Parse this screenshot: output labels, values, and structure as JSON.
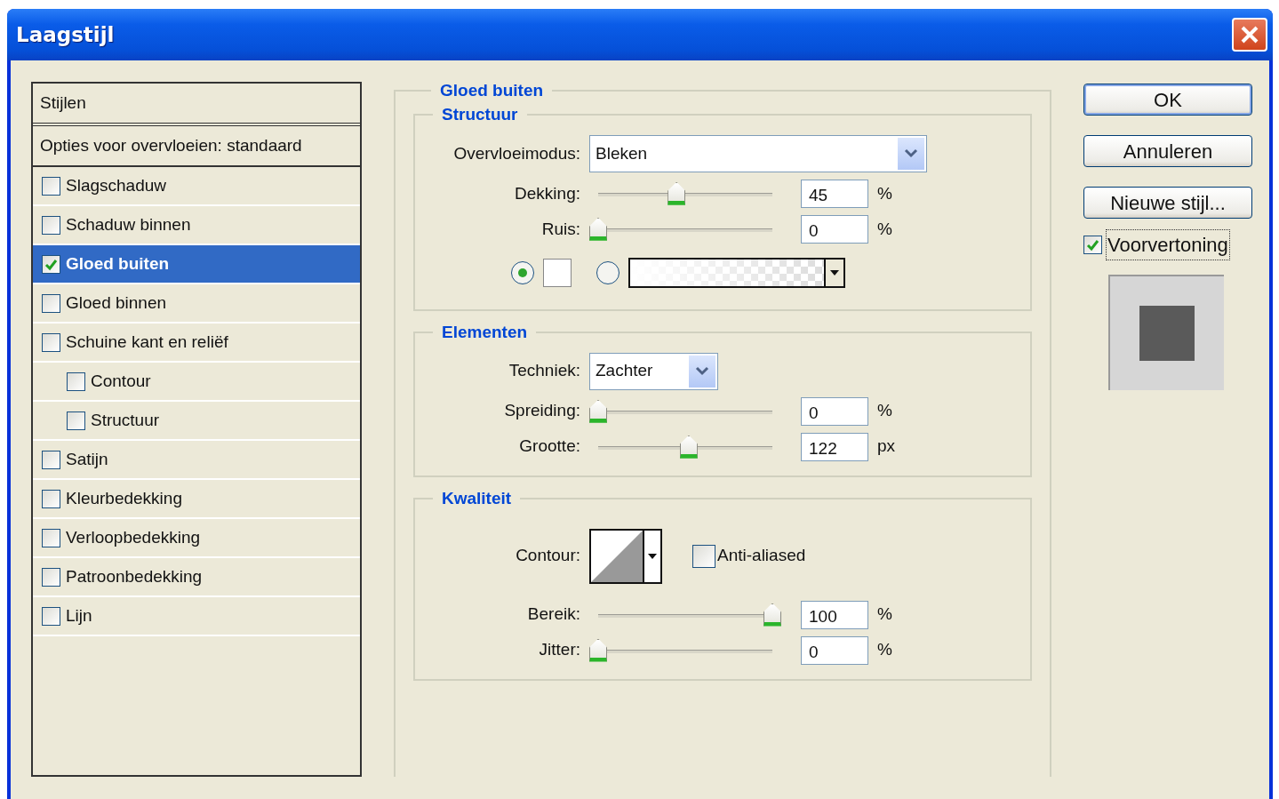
{
  "window": {
    "title": "Laagstijl"
  },
  "style_list": {
    "header": "Stijlen",
    "blend_options": "Opties voor overvloeien: standaard",
    "items": [
      {
        "label": "Slagschaduw",
        "checked": false,
        "selected": false
      },
      {
        "label": "Schaduw binnen",
        "checked": false,
        "selected": false
      },
      {
        "label": "Gloed buiten",
        "checked": true,
        "selected": true
      },
      {
        "label": "Gloed binnen",
        "checked": false,
        "selected": false
      },
      {
        "label": "Schuine kant en reliëf",
        "checked": false,
        "selected": false,
        "children": [
          {
            "label": "Contour",
            "checked": false,
            "selected": false
          },
          {
            "label": "Structuur",
            "checked": false,
            "selected": false
          }
        ]
      },
      {
        "label": "Satijn",
        "checked": false,
        "selected": false
      },
      {
        "label": "Kleurbedekking",
        "checked": false,
        "selected": false
      },
      {
        "label": "Verloopbedekking",
        "checked": false,
        "selected": false
      },
      {
        "label": "Patroonbedekking",
        "checked": false,
        "selected": false
      },
      {
        "label": "Lijn",
        "checked": false,
        "selected": false
      }
    ]
  },
  "panel": {
    "title": "Gloed buiten",
    "groups": [
      {
        "title": "Structuur",
        "rows": [
          {
            "kind": "dropdown",
            "label": "Overvloeimodus:",
            "value": "Bleken"
          },
          {
            "kind": "slider",
            "label": "Dekking:",
            "level": 0.45,
            "value": "45",
            "unit": "%"
          },
          {
            "kind": "slider",
            "label": "Ruis:",
            "level": 0,
            "value": "0",
            "unit": "%"
          },
          {
            "kind": "fill",
            "options": [
              {
                "kind": "color",
                "selected": true
              },
              {
                "kind": "gradient",
                "selected": false
              }
            ]
          }
        ]
      },
      {
        "title": "Elementen",
        "rows": [
          {
            "kind": "dropdown",
            "label": "Techniek:",
            "value": "Zachter"
          },
          {
            "kind": "slider",
            "label": "Spreiding:",
            "level": 0,
            "value": "0",
            "unit": "%"
          },
          {
            "kind": "slider",
            "label": "Grootte:",
            "level": 0.52,
            "value": "122",
            "unit": "px"
          }
        ]
      },
      {
        "title": "Kwaliteit",
        "rows": [
          {
            "kind": "contour",
            "label": "Contour:",
            "checkbox": {
              "label": "Anti-aliased",
              "checked": false
            }
          },
          {
            "kind": "slider",
            "label": "Bereik:",
            "level": 1,
            "value": "100",
            "unit": "%"
          },
          {
            "kind": "slider",
            "label": "Jitter:",
            "level": 0,
            "value": "0",
            "unit": "%"
          }
        ]
      }
    ]
  },
  "buttons": [
    {
      "label": "OK",
      "default": true
    },
    {
      "label": "Annuleren",
      "default": false
    },
    {
      "label": "Nieuwe stijl...",
      "default": false
    }
  ],
  "preview": {
    "label": "Voorvertoning",
    "checked": true
  }
}
